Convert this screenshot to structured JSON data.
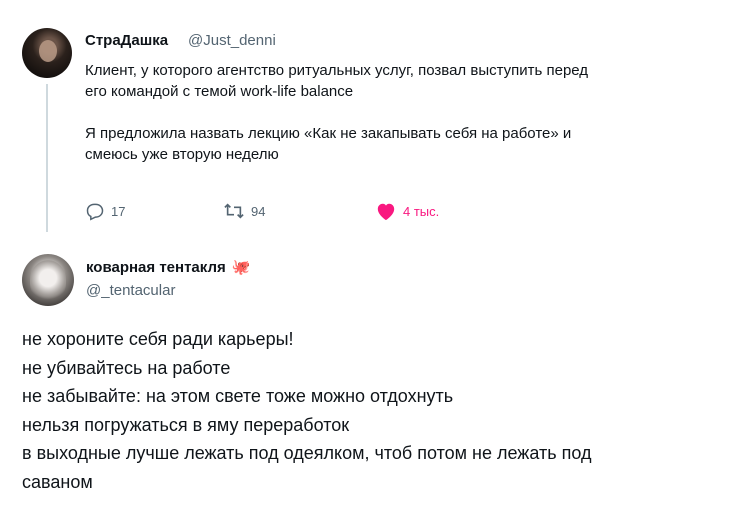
{
  "tweet1": {
    "author_name": "СтраДашка",
    "author_handle": "@Just_denni",
    "text_lines": [
      "Клиент, у которого агентство ритуальных услуг, позвал выступить перед",
      "его командой с темой work-life balance",
      "",
      "Я предложила назвать лекцию «Как не закапывать себя на работе» и",
      "смеюсь уже вторую неделю"
    ],
    "replies_count": "17",
    "retweets_count": "94",
    "likes_count": "4 тыс.",
    "icons": {
      "reply": "reply-icon",
      "retweet": "retweet-icon",
      "like": "heart-icon"
    },
    "colors": {
      "like": "#f91880",
      "muted": "#536471"
    }
  },
  "tweet2": {
    "author_name": "коварная тентакля",
    "author_emoji": "🐙",
    "author_handle": "@_tentacular",
    "text_lines": [
      "не хороните себя ради карьеры!",
      "не убивайтесь на работе",
      "не забывайте: на этом свете тоже можно отдохнуть",
      "нельзя погружаться в яму переработок",
      "в выходные лучше лежать под одеялком, чтоб потом не лежать под",
      "саваном"
    ]
  }
}
